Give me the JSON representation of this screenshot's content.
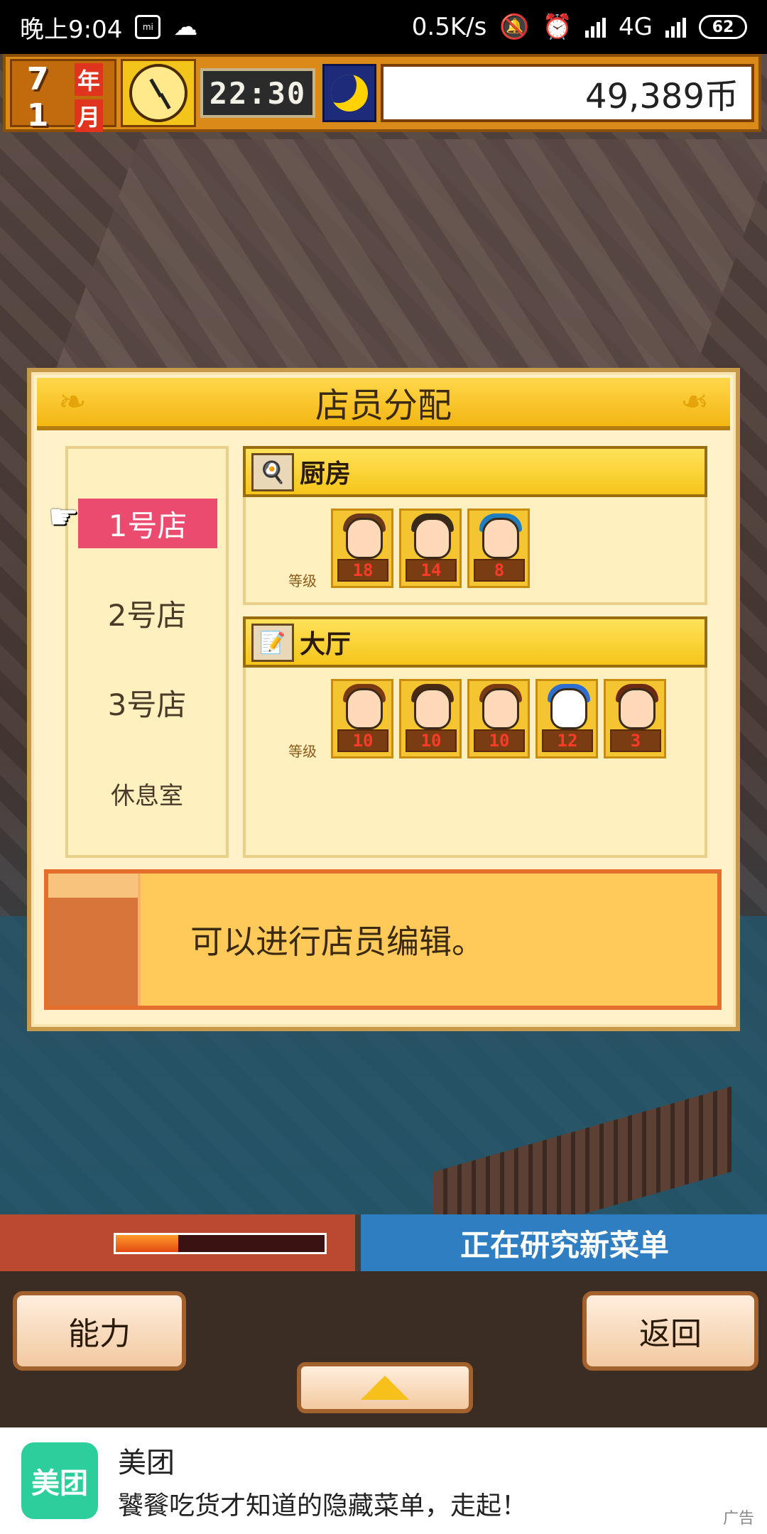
{
  "status_bar": {
    "time": "晚上9:04",
    "network_speed": "0.5K/s",
    "network_type": "4G",
    "battery": "62"
  },
  "hud": {
    "year_num": "7",
    "year_unit": "年",
    "month_num": "1",
    "month_unit": "月",
    "time": "22:30",
    "money": "49,389币"
  },
  "dialog": {
    "title": "店员分配",
    "stores": [
      {
        "label": "1号店"
      },
      {
        "label": "2号店"
      },
      {
        "label": "3号店"
      },
      {
        "label": "休息室"
      }
    ],
    "kitchen": {
      "title": "厨房",
      "level_label": "等级",
      "staff_levels": [
        "18",
        "14",
        "8"
      ]
    },
    "hall": {
      "title": "大厅",
      "level_label": "等级",
      "staff_levels": [
        "10",
        "10",
        "10",
        "12",
        "3"
      ]
    },
    "message": "可以进行店员编辑。"
  },
  "strip": {
    "research_text": "正在研究新菜单"
  },
  "controls": {
    "left_button": "能力",
    "right_button": "返回"
  },
  "ad": {
    "logo_text": "美团",
    "title": "美团",
    "subtitle": "饕餮吃货才知道的隐藏菜单，走起！",
    "tag": "广告"
  }
}
